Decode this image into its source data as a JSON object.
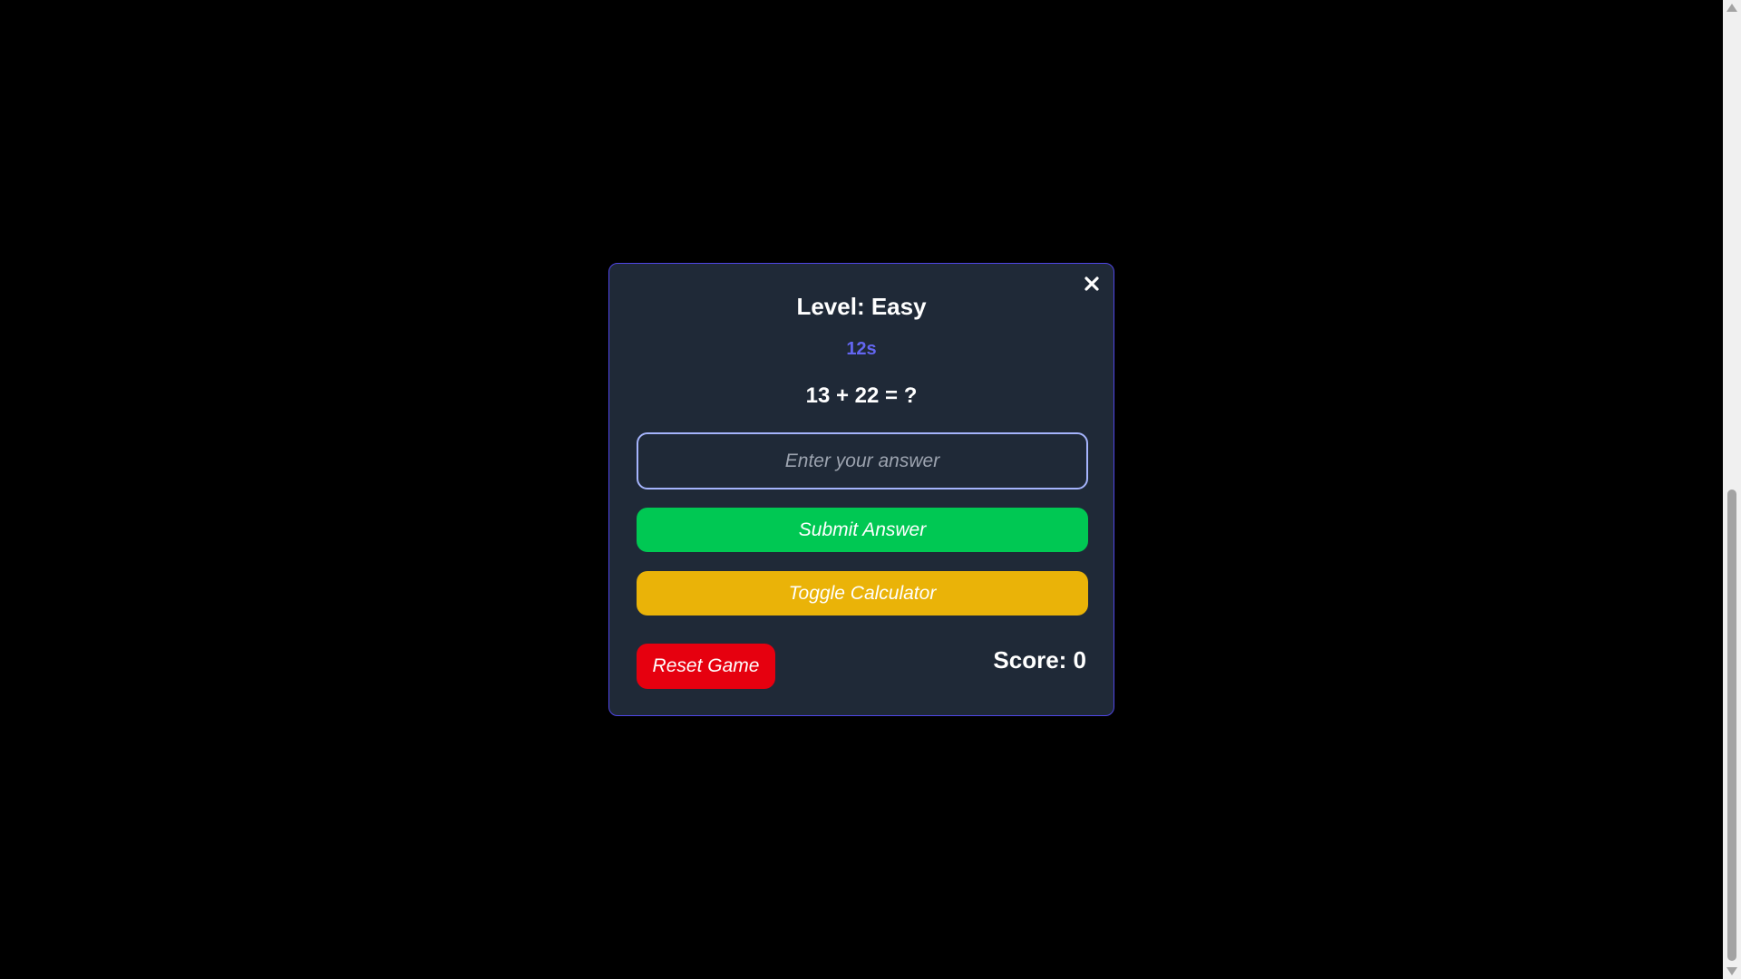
{
  "modal": {
    "title": "Level: Easy",
    "timer": "12s",
    "question": "13 + 22 = ?",
    "answer_input": {
      "value": "",
      "placeholder": "Enter your answer"
    },
    "submit_label": "Submit Answer",
    "toggle_calculator_label": "Toggle Calculator",
    "reset_label": "Reset Game",
    "score_text": "Score: 0",
    "close_icon": "close-icon"
  },
  "colors": {
    "background": "#000000",
    "modal_bg": "#1f2937",
    "modal_border": "#4f46e5",
    "timer": "#6366f1",
    "submit": "#00c853",
    "toggle": "#eab308",
    "reset": "#e6000f",
    "input_border": "#a5b4fc"
  }
}
